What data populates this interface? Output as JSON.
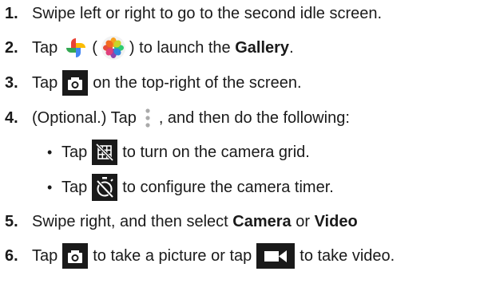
{
  "steps": [
    {
      "num": "1.",
      "text": "Swipe left or right to go to the second idle screen."
    },
    {
      "num": "2.",
      "pre": "Tap",
      "paren_open": "(",
      "mid": ") to launch the",
      "bold": "Gallery",
      "end": "."
    },
    {
      "num": "3.",
      "pre": "Tap",
      "post": "on the top-right of the screen."
    },
    {
      "num": "4.",
      "pre": "(Optional.) Tap",
      "post": ", and then do the following:"
    },
    {
      "num": "5.",
      "pre": "Swipe right, and then select",
      "bold1": "Camera",
      "or": "or",
      "bold2": "Video"
    },
    {
      "num": "6.",
      "pre": "Tap",
      "mid": "to take a picture or tap",
      "post": "to take video."
    }
  ],
  "substeps": [
    {
      "bullet": "•",
      "pre": "Tap",
      "post": "to turn on the camera grid."
    },
    {
      "bullet": "•",
      "pre": "Tap",
      "post": "to configure the camera timer."
    }
  ],
  "icons": {
    "photos": "google-photos-icon",
    "gallery": "gallery-flower-icon",
    "camera": "camera-icon",
    "more": "more-vert-icon",
    "grid": "grid-icon",
    "timer": "timer-icon",
    "video": "video-camera-icon"
  }
}
